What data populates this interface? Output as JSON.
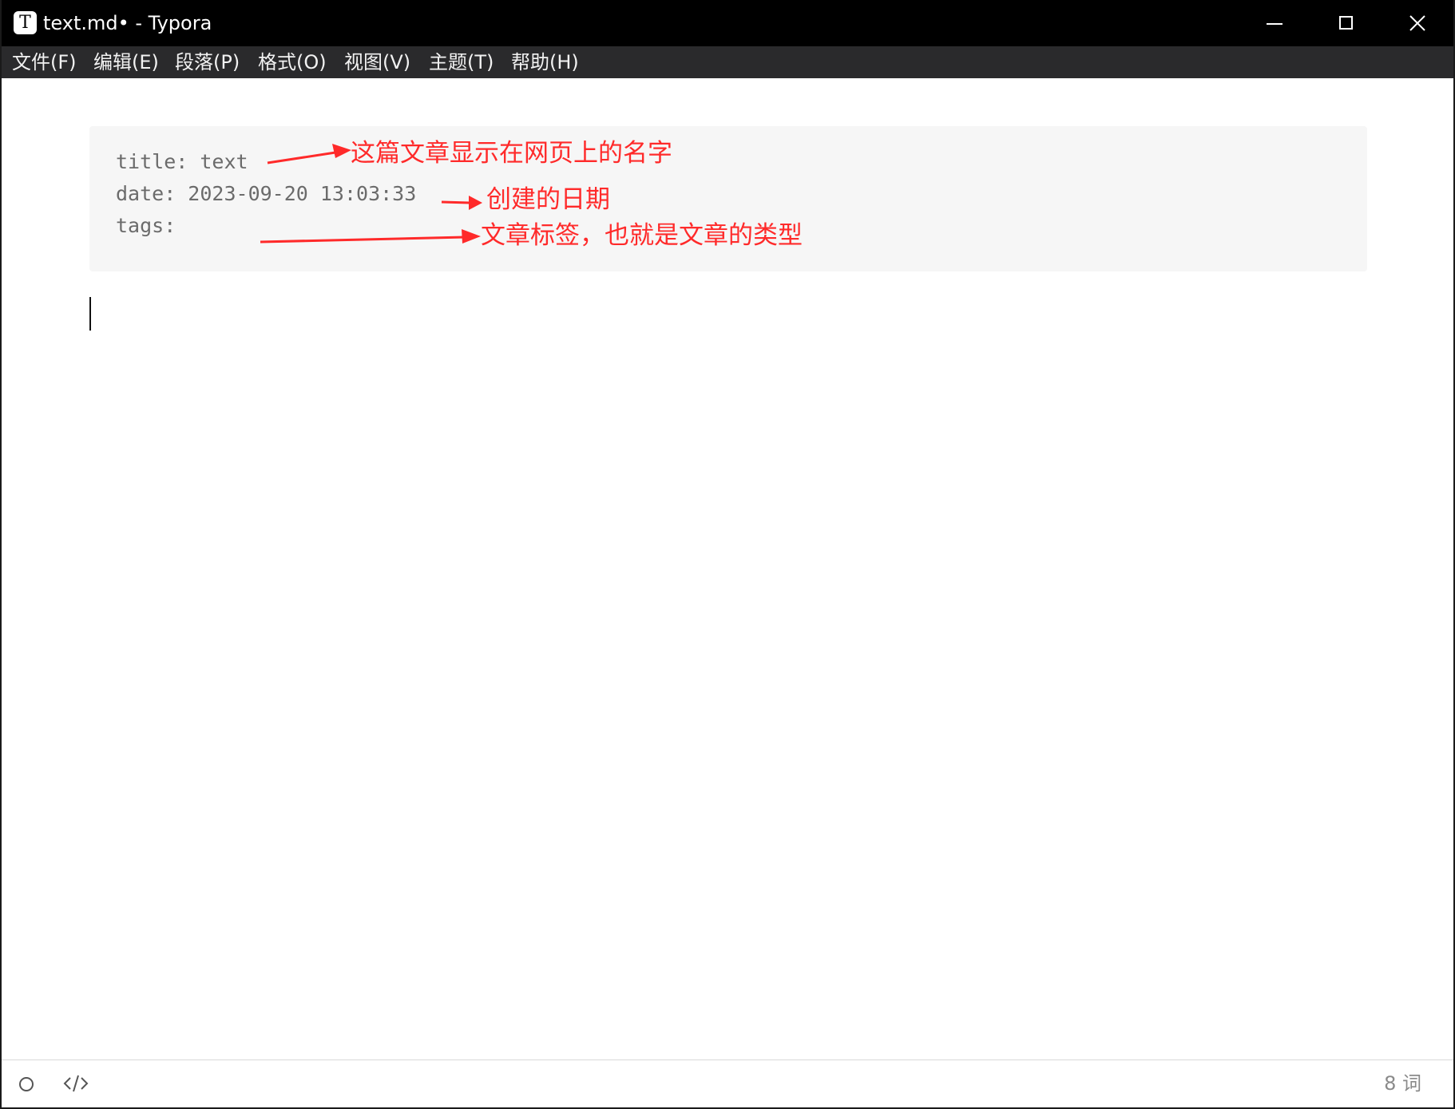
{
  "window": {
    "app_icon_letter": "T",
    "title": "text.md• - Typora"
  },
  "menu": {
    "items": [
      {
        "label": "文件(F)"
      },
      {
        "label": "编辑(E)"
      },
      {
        "label": "段落(P)"
      },
      {
        "label": "格式(O)"
      },
      {
        "label": "视图(V)"
      },
      {
        "label": "主题(T)"
      },
      {
        "label": "帮助(H)"
      }
    ]
  },
  "front_matter": {
    "title_line": "title: text",
    "date_line": "date: 2023-09-20 13:03:33",
    "tags_line": "tags:"
  },
  "annotations": {
    "title_note": "这篇文章显示在网页上的名字",
    "date_note": "创建的日期",
    "tags_note": "文章标签，也就是文章的类型",
    "color": "#ff2a2a"
  },
  "status": {
    "word_count": "8 词"
  },
  "icons": {
    "outline": "outline-toggle-icon",
    "source": "source-code-icon"
  }
}
